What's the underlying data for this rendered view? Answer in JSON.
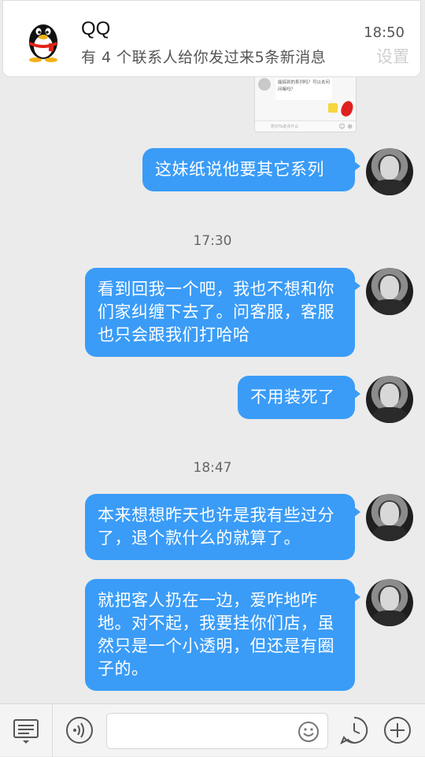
{
  "notification": {
    "app_name": "QQ",
    "time": "18:50",
    "message": "有 4 个联系人给你发过来5条新消息",
    "underlying_label": "设置"
  },
  "thumbnail": {
    "bubble_text": "能搞到的系列吗？可以去问问嘛吗？",
    "input_placeholder": "想对Ta说点什么"
  },
  "messages": [
    {
      "text": "这妹纸说他要其它系列"
    },
    {
      "text": "看到回我一个吧，我也不想和你们家纠缠下去了。问客服，客服也只会跟我们打哈哈"
    },
    {
      "text": "不用装死了"
    },
    {
      "text": "本来想想昨天也许是我有些过分了，退个款什么的就算了。"
    },
    {
      "text": "就把客人扔在一边，爱咋地咋地。对不起，我要挂你们店，虽然只是一个小透明，但还是有圈子的。"
    }
  ],
  "timestamps": [
    "17:30",
    "18:47"
  ],
  "colors": {
    "bubble": "#3a9cf7",
    "chat_background": "#ebebeb",
    "toolbar_background": "#f4f4f4"
  },
  "toolbar": {
    "icons": [
      "menu-icon",
      "voice-icon",
      "emoji-icon",
      "history-icon",
      "add-icon"
    ]
  }
}
